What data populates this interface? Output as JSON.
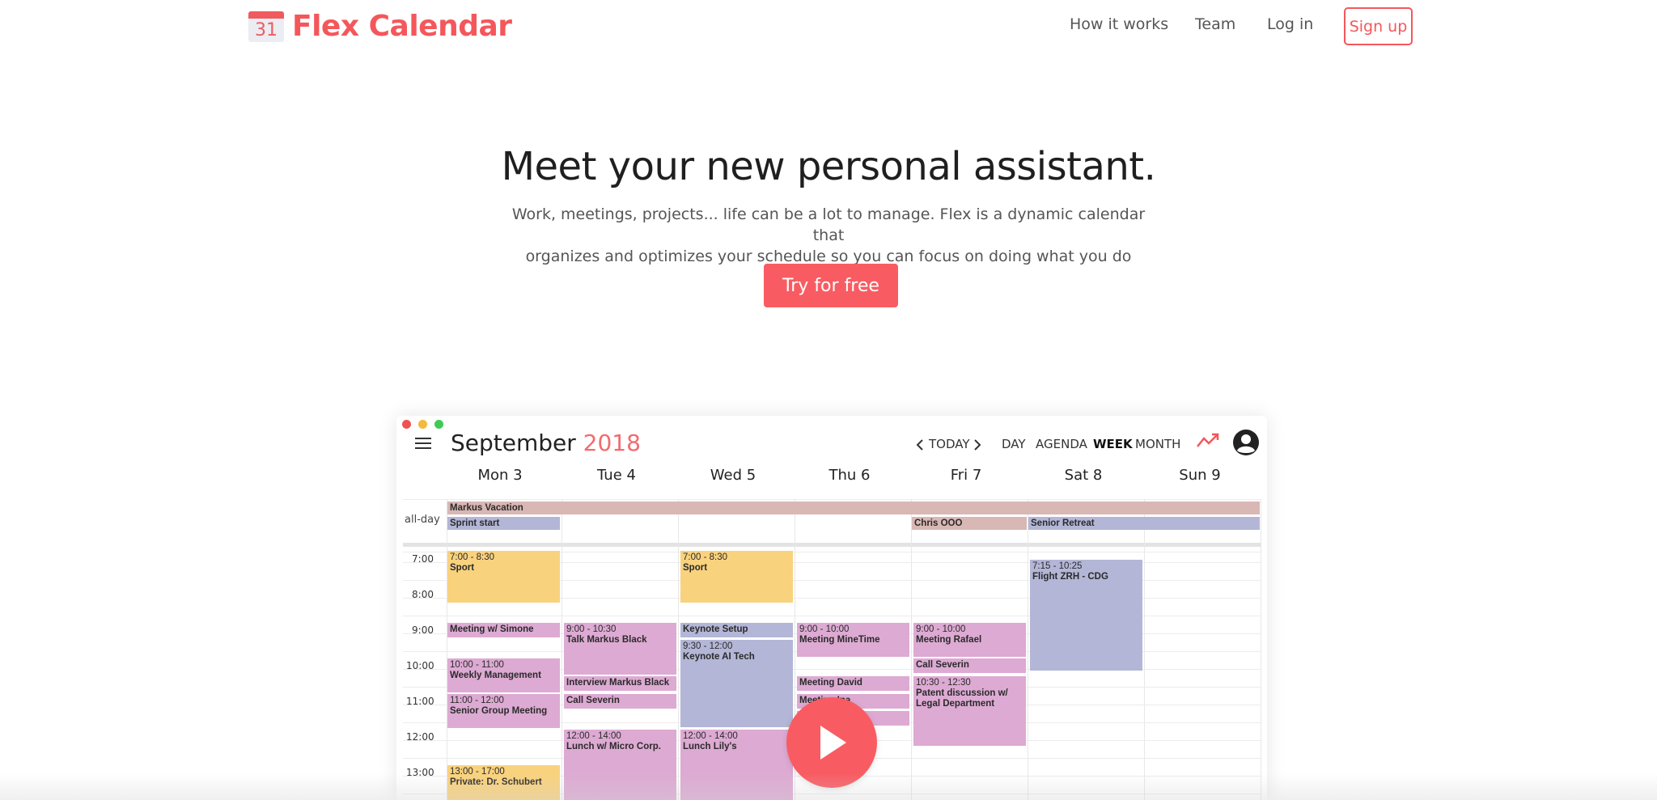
{
  "brand": {
    "logo_day": "31",
    "name": "Flex Calendar",
    "accent_color": "#f4575b"
  },
  "nav": {
    "how_it_works": "How it works",
    "team": "Team",
    "login": "Log in",
    "signup": "Sign up"
  },
  "hero": {
    "title": "Meet your new personal assistant.",
    "subtitle_line1": "Work, meetings, projects... life can be a lot to manage. Flex is a dynamic calendar that",
    "subtitle_line2": "organizes and optimizes your schedule so you can focus on doing what you do best.",
    "cta": "Try for free"
  },
  "app": {
    "window_dots": [
      "#ef5350",
      "#f5b93b",
      "#3ecb54"
    ],
    "month": "September",
    "year": "2018",
    "toolbar": {
      "prev_icon": "chevron-left-icon",
      "today": "TODAY",
      "next_icon": "chevron-right-icon",
      "views": [
        "DAY",
        "AGENDA",
        "WEEK",
        "MONTH"
      ],
      "active_view": "WEEK",
      "trend_icon": "trend-icon",
      "account_icon": "account-icon"
    },
    "days": [
      "Mon 3",
      "Tue 4",
      "Wed 5",
      "Thu 6",
      "Fri 7",
      "Sat 8",
      "Sun 9"
    ],
    "allday_label": "all-day",
    "hours": [
      "7:00",
      "8:00",
      "9:00",
      "10:00",
      "11:00",
      "12:00",
      "13:00"
    ],
    "allday_events": [
      {
        "title": "Markus Vacation",
        "color": "rose"
      },
      {
        "title": "Sprint start",
        "color": "lav"
      },
      {
        "title": "Chris OOO",
        "color": "rose"
      },
      {
        "title": "Senior Retreat",
        "color": "lav"
      }
    ],
    "events": [
      {
        "day": "Mon 3",
        "time": "7:00 - 8:30",
        "title": "Sport",
        "color": "orange"
      },
      {
        "day": "Mon 3",
        "time": "",
        "title": "Meeting w/ Simone",
        "color": "pink"
      },
      {
        "day": "Mon 3",
        "time": "10:00 - 11:00",
        "title": "Weekly Management",
        "color": "pink"
      },
      {
        "day": "Mon 3",
        "time": "11:00 - 12:00",
        "title": "Senior Group Meeting",
        "color": "pink"
      },
      {
        "day": "Mon 3",
        "time": "13:00 - 17:00",
        "title": "Private: Dr. Schubert",
        "color": "orange"
      },
      {
        "day": "Tue 4",
        "time": "9:00 - 10:30",
        "title": "Talk Markus Black",
        "color": "pink"
      },
      {
        "day": "Tue 4",
        "time": "",
        "title": "Interview Markus Black",
        "color": "pink"
      },
      {
        "day": "Tue 4",
        "time": "",
        "title": "Call Severin",
        "color": "pink"
      },
      {
        "day": "Tue 4",
        "time": "12:00 - 14:00",
        "title": "Lunch w/ Micro Corp.",
        "color": "pink"
      },
      {
        "day": "Wed 5",
        "time": "7:00 - 8:30",
        "title": "Sport",
        "color": "orange"
      },
      {
        "day": "Wed 5",
        "time": "",
        "title": "Keynote Setup",
        "color": "lav"
      },
      {
        "day": "Wed 5",
        "time": "9:30 - 12:00",
        "title": "Keynote AI Tech",
        "color": "lav"
      },
      {
        "day": "Wed 5",
        "time": "12:00 - 14:00",
        "title": "Lunch Lily's",
        "color": "pink"
      },
      {
        "day": "Thu 6",
        "time": "9:00 - 10:00",
        "title": "Meeting MineTime",
        "color": "pink"
      },
      {
        "day": "Thu 6",
        "time": "",
        "title": "Meeting David",
        "color": "pink"
      },
      {
        "day": "Thu 6",
        "time": "",
        "title": "Meeting Ina",
        "color": "pink"
      },
      {
        "day": "Thu 6",
        "time": "",
        "title": "",
        "color": "pink"
      },
      {
        "day": "Fri 7",
        "time": "9:00 - 10:00",
        "title": "Meeting Rafael",
        "color": "pink"
      },
      {
        "day": "Fri 7",
        "time": "",
        "title": "Call Severin",
        "color": "pink"
      },
      {
        "day": "Fri 7",
        "time": "10:30 - 12:30",
        "title": "Patent discussion w/ Legal Department",
        "color": "pink"
      },
      {
        "day": "Sat 8",
        "time": "7:15 - 10:25",
        "title": "Flight ZRH - CDG",
        "color": "lav"
      }
    ],
    "colors": {
      "rose": "#d8b7b4",
      "lav": "#b3b6d6",
      "orange": "#f9d27e",
      "pink": "#ddaad3"
    },
    "play_icon": "play-icon"
  }
}
